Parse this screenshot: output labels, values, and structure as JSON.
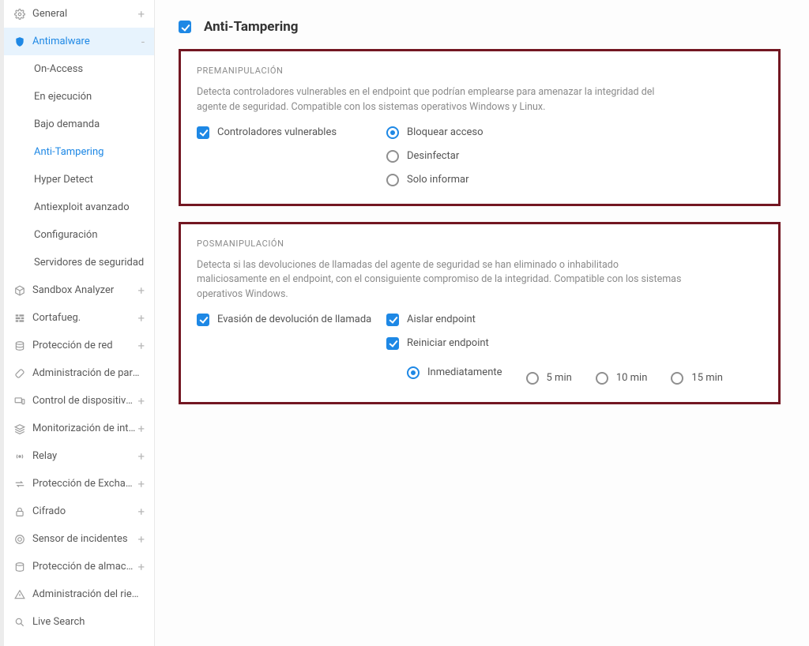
{
  "sidebar": {
    "items": [
      {
        "label": "General",
        "icon": "gear",
        "expand": "+"
      },
      {
        "label": "Antimalware",
        "icon": "shield",
        "expand": "-",
        "selected": true
      },
      {
        "label": "Sandbox Analyzer",
        "icon": "cube",
        "expand": "+"
      },
      {
        "label": "Cortafueg.",
        "icon": "firewall",
        "expand": "+"
      },
      {
        "label": "Protección de red",
        "icon": "stack",
        "expand": "+"
      },
      {
        "label": "Administración de parches",
        "icon": "patch",
        "expand": ""
      },
      {
        "label": "Control de dispositivos",
        "icon": "devices",
        "expand": "+"
      },
      {
        "label": "Monitorización de integr...",
        "icon": "layers",
        "expand": "+"
      },
      {
        "label": "Relay",
        "icon": "relay",
        "expand": "+"
      },
      {
        "label": "Protección de Exchange",
        "icon": "exchange",
        "expand": "+"
      },
      {
        "label": "Cifrado",
        "icon": "lock",
        "expand": "+"
      },
      {
        "label": "Sensor de incidentes",
        "icon": "radar",
        "expand": "+"
      },
      {
        "label": "Protección de almacena...",
        "icon": "storage",
        "expand": "+"
      },
      {
        "label": "Administración del riesgo",
        "icon": "risk",
        "expand": ""
      },
      {
        "label": "Live Search",
        "icon": "search",
        "expand": ""
      }
    ],
    "subitems": [
      {
        "label": "On-Access"
      },
      {
        "label": "En ejecución"
      },
      {
        "label": "Bajo demanda"
      },
      {
        "label": "Anti-Tampering",
        "selected": true
      },
      {
        "label": "Hyper Detect"
      },
      {
        "label": "Antiexploit avanzado"
      },
      {
        "label": "Configuración"
      },
      {
        "label": "Servidores de seguridad"
      }
    ]
  },
  "page": {
    "title": "Anti-Tampering"
  },
  "pre": {
    "heading": "PREMANIPULACIÓN",
    "description": "Detecta controladores vulnerables en el endpoint que podrían emplearse para amenazar la integridad del agente de seguridad. Compatible con los sistemas operativos Windows y Linux.",
    "option_label": "Controladores vulnerables",
    "radios": [
      {
        "label": "Bloquear acceso",
        "on": true
      },
      {
        "label": "Desinfectar",
        "on": false
      },
      {
        "label": "Solo informar",
        "on": false
      }
    ]
  },
  "post": {
    "heading": "POSMANIPULACIÓN",
    "description": "Detecta si las devoluciones de llamadas del agente de seguridad se han eliminado o inhabilitado maliciosamente en el endpoint, con el consiguiente compromiso de la integridad. Compatible con los sistemas operativos Windows.",
    "left_option": "Evasión de devolución de llamada",
    "right_options": [
      {
        "label": "Aislar endpoint"
      },
      {
        "label": "Reiniciar endpoint"
      }
    ],
    "restart_radios": [
      {
        "label": "Inmediatamente",
        "on": true
      },
      {
        "label": "5 min",
        "on": false
      },
      {
        "label": "10 min",
        "on": false
      },
      {
        "label": "15 min",
        "on": false
      }
    ]
  }
}
